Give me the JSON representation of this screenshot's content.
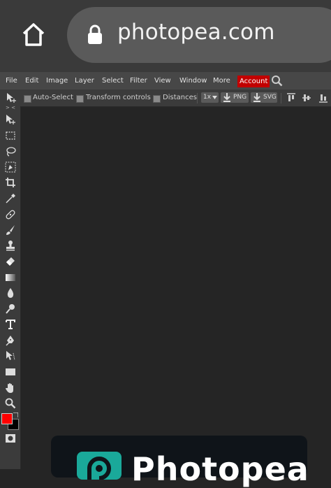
{
  "browser": {
    "url": "photopea.com",
    "icons": {
      "home": "home-icon",
      "lock": "lock-icon"
    }
  },
  "menubar": {
    "items": [
      "File",
      "Edit",
      "Image",
      "Layer",
      "Select",
      "Filter",
      "View",
      "Window",
      "More",
      "Account"
    ],
    "accent_color": "#c20000",
    "search_icon": "search-icon"
  },
  "options": {
    "auto_select": "Auto-Select",
    "transform_controls": "Transform controls",
    "distances": "Distances",
    "zoom": "1x",
    "png": "PNG",
    "svg": "SVG"
  },
  "toolbar": {
    "collapse": "> <",
    "tools": [
      "move-tool-icon",
      "marquee-tool-icon",
      "lasso-tool-icon",
      "quick-select-tool-icon",
      "crop-tool-icon",
      "eyedropper-tool-icon",
      "healing-brush-tool-icon",
      "brush-tool-icon",
      "clone-stamp-tool-icon",
      "eraser-tool-icon",
      "gradient-tool-icon",
      "blur-tool-icon",
      "dodge-tool-icon",
      "type-tool-icon",
      "pen-tool-icon",
      "path-select-tool-icon",
      "rectangle-tool-icon",
      "hand-tool-icon",
      "zoom-tool-icon"
    ],
    "foreground_color": "#ff0000",
    "background_color": "#000000"
  },
  "splash": {
    "title": "Photopea",
    "brand_color": "#1aa99a"
  }
}
